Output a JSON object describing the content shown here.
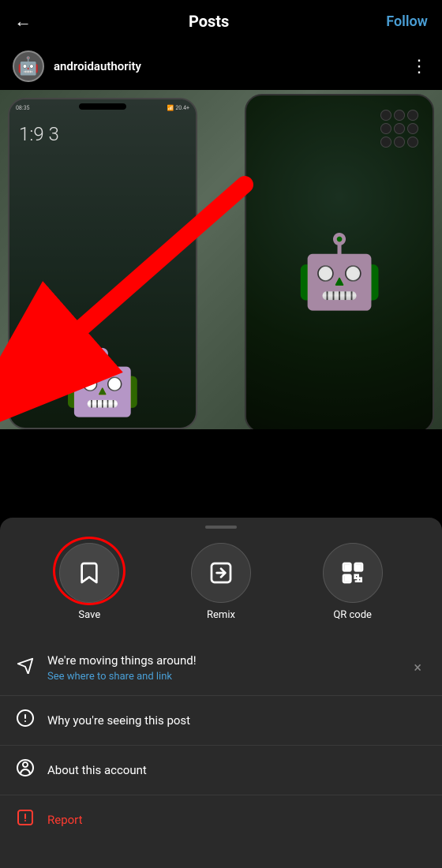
{
  "nav": {
    "back_label": "←",
    "title": "Posts",
    "follow_label": "Follow"
  },
  "account": {
    "username": "androidauthority",
    "avatar_icon": "👤"
  },
  "post": {
    "image_alt": "Android phones with robot wallpaper"
  },
  "sheet": {
    "handle_label": "",
    "actions": [
      {
        "id": "save",
        "label": "Save",
        "icon": "🔖"
      },
      {
        "id": "remix",
        "label": "Remix",
        "icon": "🔄"
      },
      {
        "id": "qr",
        "label": "QR code",
        "icon": "⬛"
      }
    ],
    "notice": {
      "icon": "✈",
      "text": "We're moving things around!",
      "subtext": "See where to share and link",
      "close": "×"
    },
    "menu_items": [
      {
        "id": "why-seeing",
        "icon": "ℹ",
        "text": "Why you're seeing this post",
        "red": false
      },
      {
        "id": "about-account",
        "icon": "👤",
        "text": "About this account",
        "red": false
      },
      {
        "id": "report",
        "icon": "⚠",
        "text": "Report",
        "red": true
      }
    ]
  }
}
